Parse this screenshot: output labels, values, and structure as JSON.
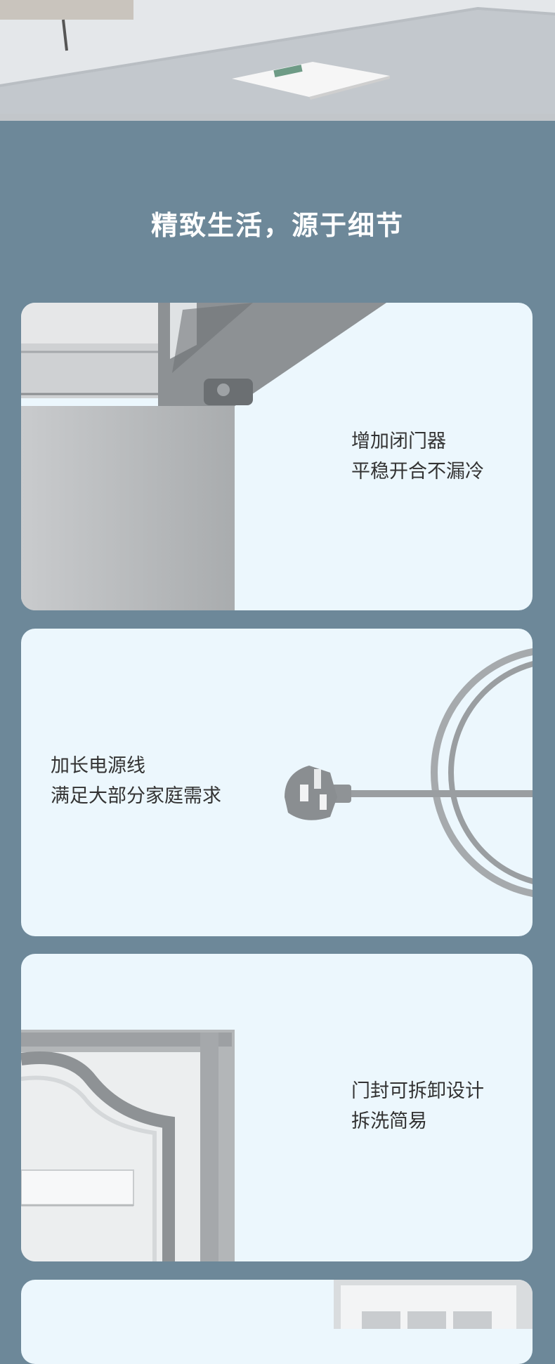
{
  "section": {
    "title": "精致生活，源于细节"
  },
  "features": [
    {
      "line1": "增加闭门器",
      "line2": "平稳开合不漏冷"
    },
    {
      "line1": "加长电源线",
      "line2": "满足大部分家庭需求"
    },
    {
      "line1": "门封可拆卸设计",
      "line2": "拆洗简易"
    }
  ],
  "colors": {
    "page_background": "#6d8899",
    "card_background": "#ecf7fd",
    "title_text": "#ffffff",
    "body_text": "#333333"
  }
}
